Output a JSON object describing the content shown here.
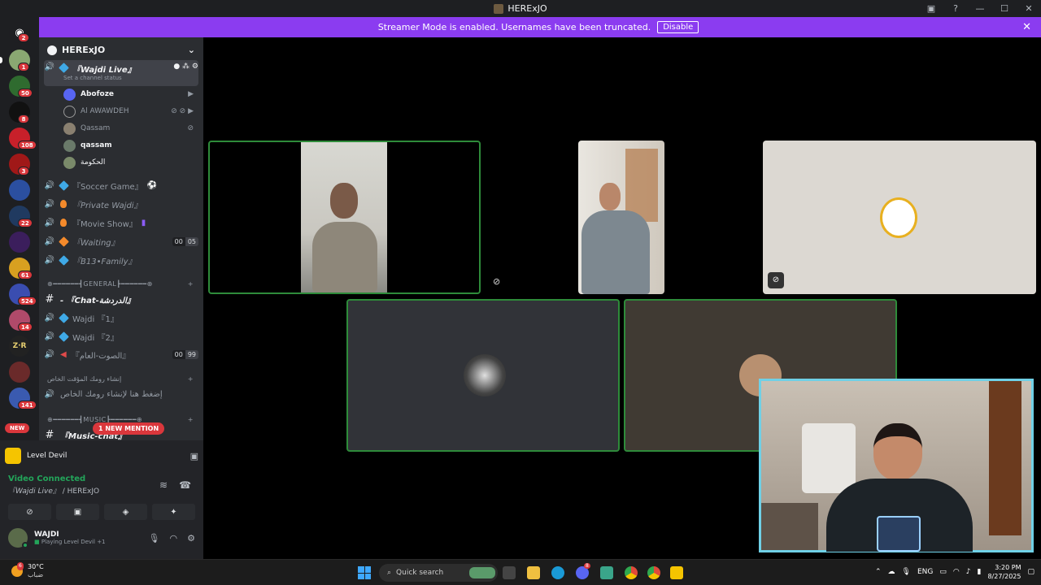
{
  "window": {
    "title": "HERExJO"
  },
  "banner": {
    "message": "Streamer Mode is enabled. Usernames have been truncated.",
    "disable_label": "Disable"
  },
  "guilds": [
    {
      "badge": "2",
      "color": "#5865f2"
    },
    {
      "badge": "1",
      "color": "#8aa872"
    },
    {
      "badge": "50",
      "color": "#2f6b2f"
    },
    {
      "badge": "8",
      "color": "#111111"
    },
    {
      "badge": "108",
      "color": "#c8202a"
    },
    {
      "badge": "3",
      "color": "#a01818"
    },
    {
      "badge": "",
      "color": "#2b4fa0"
    },
    {
      "badge": "22",
      "color": "#203a60"
    },
    {
      "badge": "",
      "color": "#3b1e5c"
    },
    {
      "badge": "61",
      "color": "#d8a020"
    },
    {
      "badge": "524",
      "color": "#3a4db0"
    },
    {
      "badge": "14",
      "color": "#b04a6a"
    },
    {
      "badge": "",
      "color": "#222222",
      "text": "Z·R"
    },
    {
      "badge": "",
      "color": "#6a2a2a"
    },
    {
      "badge": "141",
      "color": "#3a5ab0"
    }
  ],
  "server": {
    "name": "HERExJO"
  },
  "channels": {
    "active_voice": {
      "name": "『Wajdi Live』",
      "status": "Set a channel status"
    },
    "members": [
      "Abofoze",
      "Al AWAWDEH",
      "Qassam",
      "qassam",
      "الحكومة"
    ],
    "voice": [
      {
        "name": "『Soccer Game』",
        "icon": "diamond"
      },
      {
        "name": "『Private Wajdi』",
        "icon": "flame"
      },
      {
        "name": "『Movie Show』",
        "icon": "flame"
      },
      {
        "name": "『Waiting』",
        "icon": "diamond-orange",
        "count_a": "00",
        "count_b": "05"
      },
      {
        "name": "『B13•Family』",
        "icon": "diamond"
      }
    ],
    "category_general": "⊕━━━━━━┫GENERAL┣━━━━━━⊕",
    "general": [
      {
        "name": "- 『Chat-الدردشة』",
        "type": "text"
      },
      {
        "name": "Wajdi 『1』",
        "type": "voice"
      },
      {
        "name": "Wajdi 『2』",
        "type": "voice"
      },
      {
        "name": "『الصوت-العام』",
        "type": "voice",
        "count_a": "00",
        "count_b": "99"
      }
    ],
    "category_room": "إنشاء رومك المؤقت الخاص",
    "room_channel": "إضغط هنا لإنشاء رومك الخاص",
    "category_music": "⊕━━━━━━┫MUSIC┣━━━━━━⊕",
    "music_channel": "『Music-chat』",
    "new_pill": "NEW",
    "mention_pill": "1 NEW MENTION"
  },
  "activity": {
    "name": "Level Devil"
  },
  "voice_connection": {
    "status": "Video Connected",
    "channel": "『Wajdi Live』",
    "server": "/ HERExJO"
  },
  "me": {
    "name": "WAJDI",
    "status": "Playing Level Devil",
    "extra": "+1"
  },
  "taskbar": {
    "temp": "30°C",
    "weather": "ضباب",
    "search_placeholder": "Quick search",
    "lang": "ENG",
    "time": "3:20 PM",
    "date": "8/27/2025",
    "notif_badge": "6",
    "discord_badge": "8"
  },
  "colors": {
    "accent": "#8b3cf0",
    "speaking": "#2e8b3a",
    "danger": "#da373c",
    "online": "#23a55a"
  }
}
